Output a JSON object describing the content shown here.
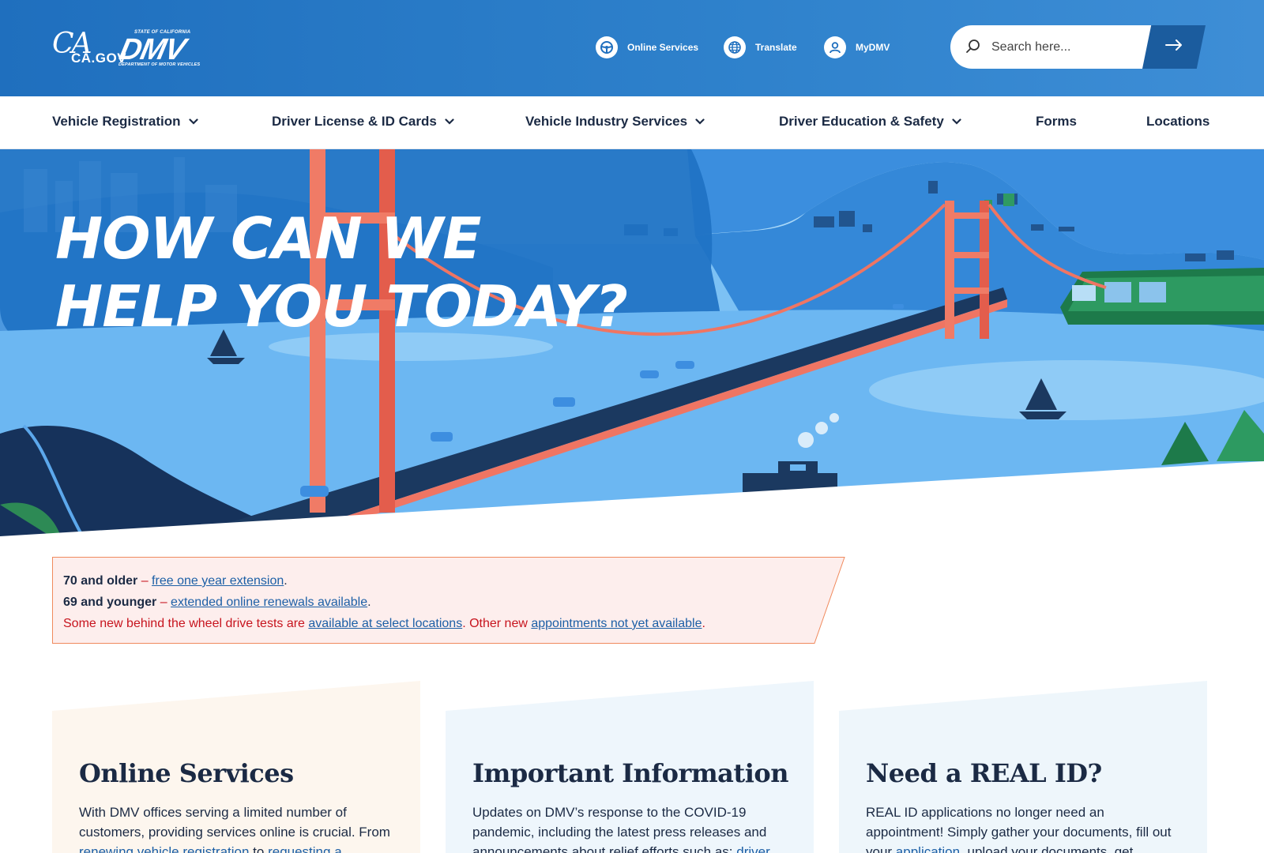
{
  "header": {
    "ca_logo": "CA.GOV",
    "dmv_logo": {
      "state": "STATE OF CALIFORNIA",
      "name": "DMV",
      "department": "DEPARTMENT OF MOTOR VEHICLES"
    },
    "utility_links": [
      {
        "label": "Online Services",
        "icon": "steering-wheel-icon"
      },
      {
        "label": "Translate",
        "icon": "globe-icon"
      },
      {
        "label": "MyDMV",
        "icon": "user-icon"
      }
    ],
    "search": {
      "placeholder": "Search here...",
      "icon": "search-icon",
      "button_icon": "arrow-right-icon"
    },
    "colors": {
      "brand_blue": "#1f6fbe",
      "dark_blue": "#1b5c9e"
    }
  },
  "nav": {
    "items": [
      {
        "label": "Vehicle Registration",
        "dropdown": true
      },
      {
        "label": "Driver License & ID Cards",
        "dropdown": true
      },
      {
        "label": "Vehicle Industry Services",
        "dropdown": true
      },
      {
        "label": "Driver Education & Safety",
        "dropdown": true
      },
      {
        "label": "Forms",
        "dropdown": false
      },
      {
        "label": "Locations",
        "dropdown": false
      }
    ]
  },
  "hero": {
    "title_line1": "HOW CAN WE",
    "title_line2": "HELP YOU TODAY?"
  },
  "alert": {
    "line1": {
      "bold": "70 and older",
      "sep": " – ",
      "link": "free one year extension",
      "end": "."
    },
    "line2": {
      "bold": "69 and younger",
      "sep": " – ",
      "link": "extended online renewals available",
      "end": "."
    },
    "line3": {
      "text1": "Some new behind the wheel drive tests are ",
      "link1": "available at select locations",
      "text2": ". Other new ",
      "link2": "appointments not yet available",
      "end": "."
    },
    "colors": {
      "background": "#fdeeed",
      "border": "#f08a5d",
      "text_red": "#c7141e"
    }
  },
  "cards": [
    {
      "title": "Online Services",
      "text1": "With DMV offices serving a limited number of customers, providing services online is crucial. From ",
      "link1": "renewing vehicle registration",
      "text2": " to ",
      "link2": "requesting a",
      "bg": "#fdf6ee"
    },
    {
      "title": "Important Information",
      "text1": "Updates on DMV’s response to the COVID-19 pandemic, including the latest press releases and announcements about relief efforts such as: ",
      "link1": "driver",
      "bg": "#eef6fc"
    },
    {
      "title": "Need a REAL ID?",
      "text1": "REAL ID applications no longer need an appointment! Simply gather your documents, fill out your ",
      "link1": "application",
      "text2": ", upload your documents, get",
      "bg": "#eef6fb"
    }
  ]
}
